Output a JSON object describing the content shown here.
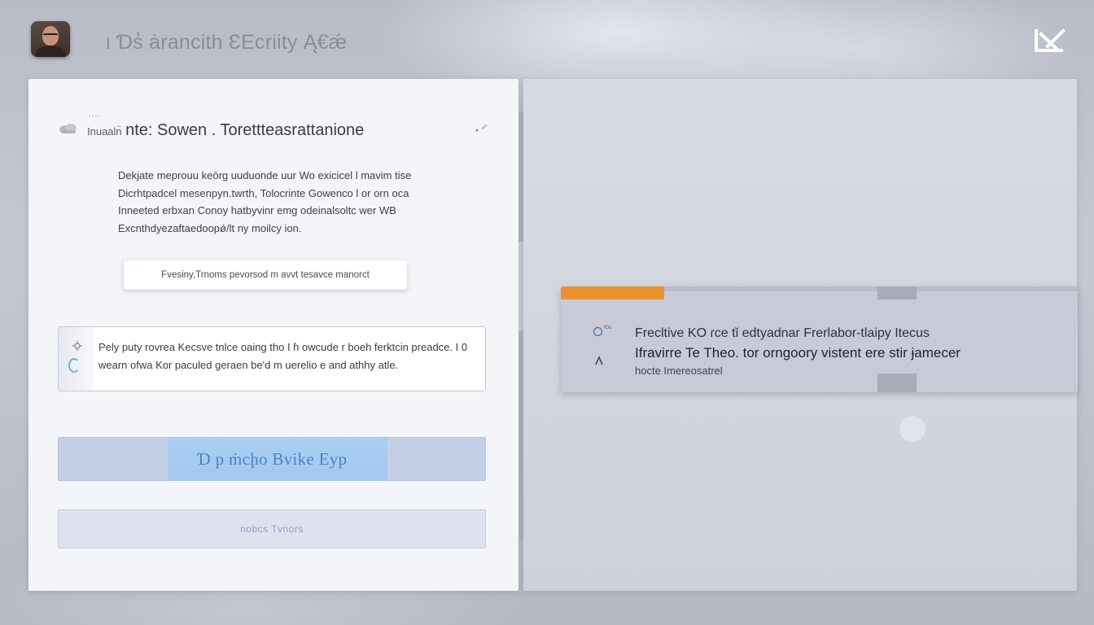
{
  "header": {
    "title": "ι Ɗs̓ ȧrancith ƐEcriity Ą€ǽ",
    "avatar_icon": "user-avatar",
    "close_icon": "close-icon"
  },
  "left_panel": {
    "dots": "....",
    "header_small": "Inuaaln̈",
    "header_large": "nte: Sowen . Torettteasrattanione",
    "cloud_icon": "cloud-icon",
    "pin_icon": "pin-icon",
    "description": "Dekjate meprouu keōrg uuduonde uur Wo exicicel l mavim tise Dicrhtpadcel mesenpyn.twrth, Tolocrinte Gowenco l or orn oca Inneeted erbxan Conoy hatbyvinr emg odeinalsoltc wer WB Excnthdyezaftaedoopǿ/lt ny moilcy ion.",
    "hint": "Fvesiny,Trnoms pevorsod m avvt tesavce manorct",
    "notice": {
      "gear_icon": "gear-icon",
      "text": "Pely puty rovrea Kecsve tnlce oaing tho I ɦ owcude r boeh ferktcin preadce. I 0 wearn ofwa Kor paculed geraen be'd m uerelio e and athhy atle."
    },
    "primary_button": "Ɗ p ṁcḩo Bvike Eyp",
    "secondary_button": "nobcs Tvnors"
  },
  "toast": {
    "progress": 0.2,
    "accent_color": "#e8922f",
    "info_icon": "info-circle-icon",
    "icon_label": "ᴵᴼˢ",
    "arrow_icon": "arrow-up-icon",
    "line1": "Frecltive KO ɾce tǐ edtyadnar Frerlabor-tlaipy Itecus",
    "line2": "Ifravirre Te Theo. tor orngoory vistent ere stir ɉamecer",
    "line3": "hocte Imereosatrel"
  }
}
